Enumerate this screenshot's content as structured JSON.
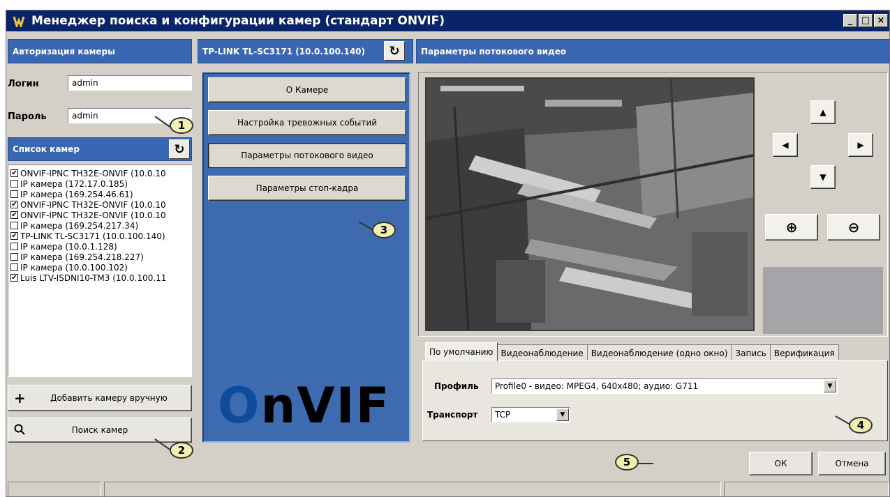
{
  "window": {
    "title": "Менеджер поиска и конфигурации камер (стандарт ONVIF)",
    "controls": {
      "minimize": "_",
      "maximize": "□",
      "close": "×"
    }
  },
  "auth": {
    "header": "Авторизация камеры",
    "login_label": "Логин",
    "login_value": "admin",
    "password_label": "Пароль",
    "password_value": "admin"
  },
  "camera_list": {
    "header": "Список камер",
    "refresh_icon": "refresh-icon",
    "items": [
      {
        "label": "ONVIF-IPNC TH32E-ONVIF (10.0.10",
        "checked": true
      },
      {
        "label": "IP камера (172.17.0.185)",
        "checked": false
      },
      {
        "label": "IP камера (169.254.46.61)",
        "checked": false
      },
      {
        "label": "ONVIF-IPNC TH32E-ONVIF (10.0.10",
        "checked": true
      },
      {
        "label": "ONVIF-IPNC TH32E-ONVIF (10.0.10",
        "checked": true
      },
      {
        "label": "IP камера (169.254.217.34)",
        "checked": false
      },
      {
        "label": "TP-LINK TL-SC3171 (10.0.100.140)",
        "checked": true
      },
      {
        "label": "IP камера (10.0.1.128)",
        "checked": false
      },
      {
        "label": "IP камера (169.254.218.227)",
        "checked": false
      },
      {
        "label": "IP камера (10.0.100.102)",
        "checked": false
      },
      {
        "label": "Luis LTV-ISDNI10-TM3 (10.0.100.11",
        "checked": true
      }
    ],
    "add_button": "Добавить камеру вручную",
    "search_button": "Поиск камер"
  },
  "camera_panel": {
    "header": "TP-LINK TL-SC3171 (10.0.100.140)",
    "menu": [
      {
        "label": "О Камере",
        "active": false
      },
      {
        "label": "Настройка тревожных событий",
        "active": false
      },
      {
        "label": "Параметры потокового видео",
        "active": true
      },
      {
        "label": "Параметры стоп-кадра",
        "active": false
      }
    ],
    "logo": {
      "first": "O",
      "rest": "nVIF"
    }
  },
  "stream": {
    "header": "Параметры потокового видео",
    "ptz": {
      "up": "▲",
      "left": "◀",
      "right": "▶",
      "down": "▼",
      "zoom_in": "⊕",
      "zoom_out": "⊖"
    },
    "tabs": [
      {
        "label": "По умолчанию",
        "active": true
      },
      {
        "label": "Видеонаблюдение",
        "active": false
      },
      {
        "label": "Видеонаблюдение (одно окно)",
        "active": false
      },
      {
        "label": "Запись",
        "active": false
      },
      {
        "label": "Верификация",
        "active": false
      }
    ],
    "profile_label": "Профиль",
    "profile_value": "Profile0 - видео: MPEG4, 640x480; аудио: G711",
    "transport_label": "Транспорт",
    "transport_value": "TCP"
  },
  "footer": {
    "ok": "ОК",
    "cancel": "Отмена"
  },
  "callouts": [
    "1",
    "2",
    "3",
    "4",
    "5"
  ],
  "colors": {
    "titlebar": "#0a246a",
    "panel_header": "#3a67b4",
    "blue_panel": "#3e6bb0",
    "callout": "#f2efb0"
  }
}
